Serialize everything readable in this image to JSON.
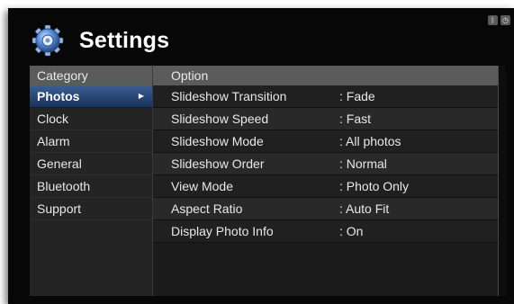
{
  "status_icons": [
    {
      "icon": "bluetooth-icon",
      "glyph": "ᛒ"
    },
    {
      "icon": "clock-icon",
      "glyph": "◷"
    }
  ],
  "header": {
    "title": "Settings",
    "icon": "gear-icon"
  },
  "categories": {
    "heading": "Category",
    "items": [
      {
        "label": "Photos",
        "selected": true
      },
      {
        "label": "Clock"
      },
      {
        "label": "Alarm"
      },
      {
        "label": "General"
      },
      {
        "label": "Bluetooth"
      },
      {
        "label": "Support"
      }
    ],
    "selected_arrow": "▶"
  },
  "options": {
    "heading": "Option",
    "rows": [
      {
        "name": "Slideshow Transition",
        "value": ": Fade"
      },
      {
        "name": "Slideshow Speed",
        "value": ": Fast"
      },
      {
        "name": "Slideshow Mode",
        "value": ": All photos"
      },
      {
        "name": "Slideshow Order",
        "value": ": Normal"
      },
      {
        "name": "View Mode",
        "value": ": Photo Only"
      },
      {
        "name": "Aspect Ratio",
        "value": ": Auto Fit"
      },
      {
        "name": "Display Photo Info",
        "value": ": On"
      }
    ]
  },
  "colors": {
    "selection_top": "#3c5f93",
    "selection_bottom": "#18325b",
    "header_bar": "#5b5b5b",
    "background": "#070707"
  }
}
